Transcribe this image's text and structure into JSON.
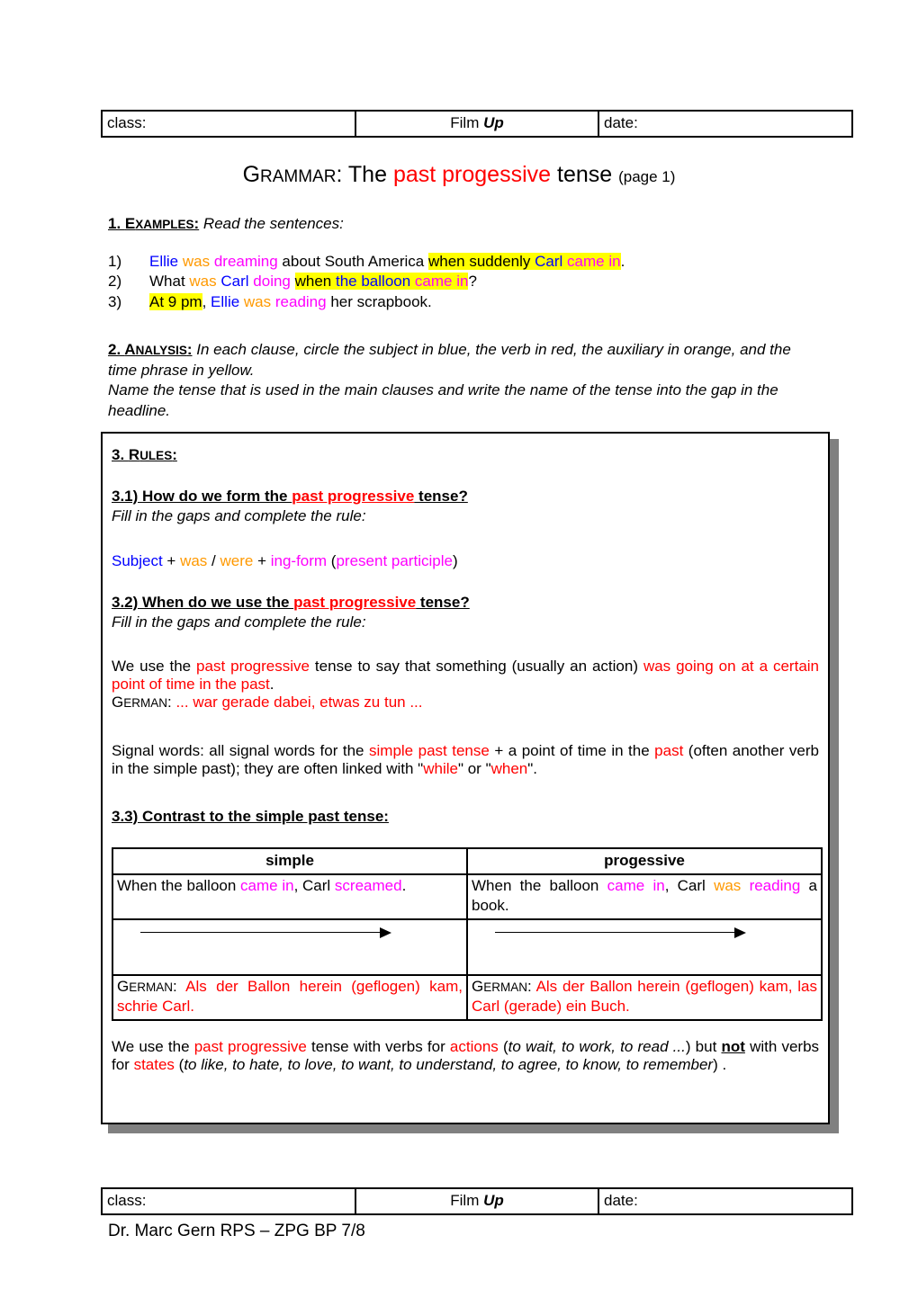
{
  "header": {
    "class_label": "class:",
    "film_prefix": "Film ",
    "film_name": "Up",
    "date_label": "date:"
  },
  "title": {
    "grammar_cap": "G",
    "grammar_rest": "RAMMAR",
    "colon_the": ": The ",
    "highlight": "past progessive",
    "tense": " tense ",
    "page": "(page 1)"
  },
  "examples": {
    "head_num": "1. ",
    "head_cap": "E",
    "head_rest": "XAMPLES",
    "head_colon": ":",
    "head_instruction": " Read the sentences:",
    "items": [
      {
        "num": "1)",
        "parts": [
          {
            "t": "Ellie",
            "c": "blue"
          },
          {
            "t": " ",
            "c": "plain"
          },
          {
            "t": "was",
            "c": "orange"
          },
          {
            "t": " ",
            "c": "plain"
          },
          {
            "t": "dreaming",
            "c": "magenta"
          },
          {
            "t": " about South America ",
            "c": "plain"
          },
          {
            "t": "when suddenly ",
            "c": "plain",
            "hl": true
          },
          {
            "t": "Carl",
            "c": "blue",
            "hl": true
          },
          {
            "t": " ",
            "c": "plain",
            "hl": true
          },
          {
            "t": "came in",
            "c": "magenta",
            "hl": true
          },
          {
            "t": ".",
            "c": "plain"
          }
        ]
      },
      {
        "num": "2)",
        "parts": [
          {
            "t": "What ",
            "c": "plain"
          },
          {
            "t": "was",
            "c": "orange"
          },
          {
            "t": " ",
            "c": "plain"
          },
          {
            "t": "Carl",
            "c": "blue"
          },
          {
            "t": " ",
            "c": "plain"
          },
          {
            "t": "doing",
            "c": "magenta"
          },
          {
            "t": " ",
            "c": "plain"
          },
          {
            "t": "when ",
            "c": "plain",
            "hl": true
          },
          {
            "t": "the balloon",
            "c": "blue",
            "hl": true
          },
          {
            "t": " ",
            "c": "plain",
            "hl": true
          },
          {
            "t": "came in",
            "c": "magenta",
            "hl": true
          },
          {
            "t": "?",
            "c": "plain"
          }
        ]
      },
      {
        "num": "3)",
        "parts": [
          {
            "t": "At 9 pm",
            "c": "plain",
            "hl": true
          },
          {
            "t": ", ",
            "c": "plain"
          },
          {
            "t": "Ellie",
            "c": "blue"
          },
          {
            "t": " ",
            "c": "plain"
          },
          {
            "t": "was",
            "c": "orange"
          },
          {
            "t": " ",
            "c": "plain"
          },
          {
            "t": "reading",
            "c": "magenta"
          },
          {
            "t": " her scrapbook.",
            "c": "plain"
          }
        ]
      }
    ]
  },
  "analysis": {
    "head_num": "2. ",
    "head_cap": "A",
    "head_rest": "NALYSIS",
    "head_colon": ":",
    "line1": " In each clause, circle the subject in blue, the verb in red, the auxiliary in orange, and the time phrase in yellow.",
    "line2": "Name the tense that is used in the main clauses and write the name of the tense into the gap in the headline."
  },
  "rules": {
    "head_num": "3. ",
    "head_cap": "R",
    "head_rest": "ULES",
    "head_colon": ": ",
    "r31": {
      "head_pre": "3.1) How do we form the ",
      "head_red": "past progressive",
      "head_post": " tense?",
      "fill": "Fill in the gaps and complete the rule:",
      "formula": [
        {
          "t": "Subject",
          "c": "blue"
        },
        {
          "t": " + ",
          "c": "plain"
        },
        {
          "t": "was",
          "c": "orange"
        },
        {
          "t": " / ",
          "c": "plain"
        },
        {
          "t": "were",
          "c": "orange"
        },
        {
          "t": " + ",
          "c": "plain"
        },
        {
          "t": "ing-form",
          "c": "magenta"
        },
        {
          "t": " (",
          "c": "plain"
        },
        {
          "t": "present participle",
          "c": "magenta"
        },
        {
          "t": ")",
          "c": "plain"
        }
      ]
    },
    "r32": {
      "head_pre": "3.2) When do we use the ",
      "head_red": "past progressive",
      "head_post": " tense?",
      "fill": "Fill in the gaps and complete the rule:",
      "body": [
        {
          "t": "We use the ",
          "c": "plain"
        },
        {
          "t": "past progressive",
          "c": "red"
        },
        {
          "t": " tense to say that something (usually an action) ",
          "c": "plain"
        },
        {
          "t": "was going on at a certain point of time in the past",
          "c": "red"
        },
        {
          "t": ".",
          "c": "plain"
        }
      ],
      "german_cap": "G",
      "german_rest": "ERMAN",
      "german_colon": ": ",
      "german_text": "... war gerade dabei, etwas zu tun ..."
    },
    "signal": [
      {
        "t": "Signal words: all signal words for the ",
        "c": "plain"
      },
      {
        "t": "simple past tense",
        "c": "red"
      },
      {
        "t": " + a point of time in the ",
        "c": "plain"
      },
      {
        "t": "past",
        "c": "red"
      },
      {
        "t": " (often another verb in the simple past); they are often linked with \"",
        "c": "plain"
      },
      {
        "t": "while",
        "c": "red"
      },
      {
        "t": "\" or \"",
        "c": "plain"
      },
      {
        "t": "when",
        "c": "red"
      },
      {
        "t": "\".",
        "c": "plain"
      }
    ],
    "r33": {
      "head": "3.3) Contrast to the simple past tense:",
      "table": {
        "headers": [
          "simple",
          "progessive"
        ],
        "sentences": [
          [
            {
              "t": "When the balloon ",
              "c": "plain"
            },
            {
              "t": "came in",
              "c": "magenta"
            },
            {
              "t": ", Carl ",
              "c": "plain"
            },
            {
              "t": "screamed",
              "c": "magenta"
            },
            {
              "t": ".",
              "c": "plain"
            }
          ],
          [
            {
              "t": "When the balloon ",
              "c": "plain"
            },
            {
              "t": "came in",
              "c": "magenta"
            },
            {
              "t": ", Carl ",
              "c": "plain"
            },
            {
              "t": "was",
              "c": "orange"
            },
            {
              "t": " ",
              "c": "plain"
            },
            {
              "t": "reading",
              "c": "magenta"
            },
            {
              "t": " a book.",
              "c": "plain"
            }
          ]
        ],
        "arrow_label": "timeline-arrow",
        "german_cap": "G",
        "german_rest": "ERMAN",
        "german_colon": ": ",
        "german": [
          "Als der Ballon herein (geflogen) kam, schrie Carl.",
          "Als der Ballon herein (geflogen) kam, las Carl (gerade) ein Buch."
        ]
      }
    },
    "closing": [
      {
        "t": "We use the ",
        "c": "plain"
      },
      {
        "t": "past progressive",
        "c": "red"
      },
      {
        "t": " tense with verbs for ",
        "c": "plain"
      },
      {
        "t": "actions",
        "c": "red"
      },
      {
        "t": " (",
        "c": "plain"
      },
      {
        "t": "to wait, to work, to read ...",
        "c": "plain",
        "i": true
      },
      {
        "t": ") but ",
        "c": "plain"
      },
      {
        "t": "not",
        "c": "plain",
        "bu": true
      },
      {
        "t": " with verbs for ",
        "c": "plain"
      },
      {
        "t": "states",
        "c": "red"
      },
      {
        "t": " (",
        "c": "plain"
      },
      {
        "t": "to like, to hate, to love, to want, to understand, to agree, to know, to remember",
        "c": "plain",
        "i": true
      },
      {
        "t": ") .",
        "c": "plain"
      }
    ]
  },
  "footer": {
    "author": "Dr. Marc Gern RPS – ZPG BP 7/8"
  },
  "colors": {
    "blue": "#0000ff",
    "orange": "#ff9900",
    "magenta": "#ff00ff",
    "red": "#ff0000",
    "highlight": "#ffff00",
    "shadow": "#808080"
  }
}
